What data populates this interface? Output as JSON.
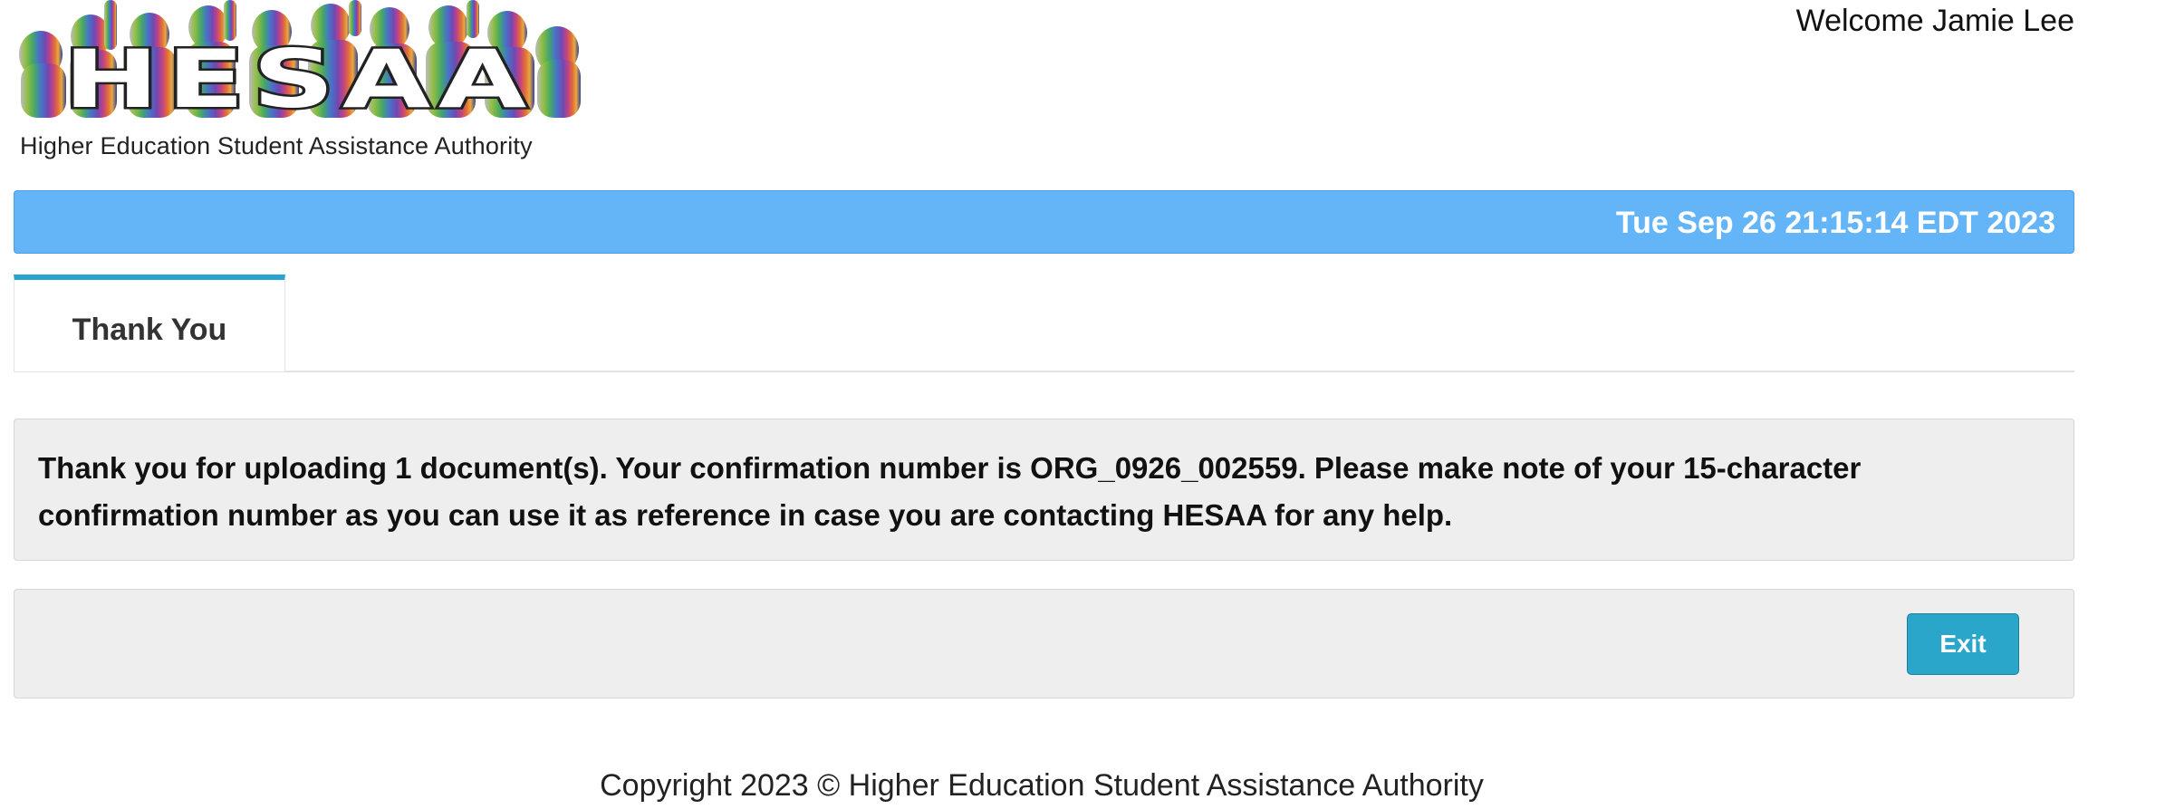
{
  "header": {
    "logo_text": "HESAA",
    "tagline": "Higher Education Student Assistance Authority",
    "welcome": "Welcome Jamie Lee"
  },
  "datebar": {
    "datetime": "Tue Sep 26 21:15:14 EDT 2023"
  },
  "tabs": [
    {
      "label": "Thank You",
      "active": true
    }
  ],
  "message": {
    "text": "Thank you for uploading 1 document(s). Your confirmation number is ORG_0926_002559. Please make note of your 15-character confirmation number as you can use it as reference in case you are contacting HESAA for any help."
  },
  "actions": {
    "exit_label": "Exit"
  },
  "footer": {
    "copyright": "Copyright 2023 © Higher Education Student Assistance Authority"
  },
  "colors": {
    "datebar": "#64b4f8",
    "tab_accent": "#2aa3d3",
    "exit_button": "#2ba6cb",
    "panel_bg": "#eeeeee"
  }
}
